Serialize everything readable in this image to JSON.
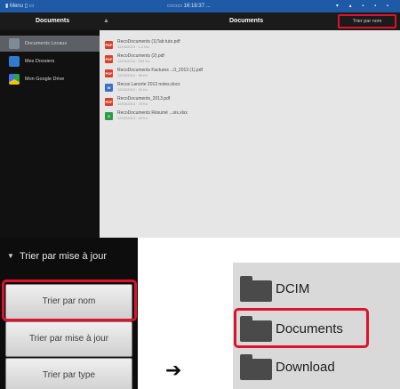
{
  "statusbar": {
    "left": "▮ Menu   ▯  ▭",
    "center": "▭▭▭ 16:18:37 ...",
    "right": "▾ ▴ ▪ ▪ ▪"
  },
  "actionbar": {
    "left_title": "Documents",
    "arrow": "▲",
    "center_title": "Documents",
    "sort_button": "Trier par nom"
  },
  "sidebar": {
    "items": [
      {
        "label": "Documents Locaux",
        "icon": "tablet-icon",
        "color": "#7f8a99",
        "active": true
      },
      {
        "label": "Mes Dossiers",
        "icon": "dropbox-icon",
        "color": "#2f7bd1",
        "active": false
      },
      {
        "label": "Mon Google Drive",
        "icon": "google-drive-icon",
        "color": "#2aa34a",
        "active": false
      }
    ],
    "toolbar": [
      "home-icon",
      "grid-icon",
      "folder-icon",
      "settings-icon"
    ]
  },
  "files": [
    {
      "name": "RecoDocuments (1)Tab tuto.pdf",
      "meta": "12/03/2013 · 1.2 Mo",
      "type": "PDF",
      "color": "#d8402e"
    },
    {
      "name": "RecoDocuments (2).pdf",
      "meta": "12/03/2013 · 340 Ko",
      "type": "PDF",
      "color": "#d8402e"
    },
    {
      "name": "RecoDocuments Factures ...0_2013 (1).pdf",
      "meta": "12/03/2013 · 98 Ko",
      "type": "PDF",
      "color": "#d8402e"
    },
    {
      "name": "Recos Lanorte 2013 notes.docx",
      "meta": "12/03/2013 · 22 Ko",
      "type": "W",
      "color": "#3a6fc4"
    },
    {
      "name": "RecoDocuments_2013.pdf",
      "meta": "12/03/2013 · 75 Ko",
      "type": "PDF",
      "color": "#d8402e"
    },
    {
      "name": "RecoDocuments Résumé ...ois.xlsx",
      "meta": "12/03/2013 · 18 Ko",
      "type": "X",
      "color": "#2e9a45"
    }
  ],
  "sort_panel": {
    "header": "Trier par mise à jour",
    "buttons": [
      "Trier par nom",
      "Trier par mise à jour",
      "Trier par type"
    ]
  },
  "next_arrow": "➔",
  "folders": [
    "DCIM",
    "Documents",
    "Download"
  ],
  "colors": {
    "highlight": "#e0112b",
    "statusbar": "#1f5aa6"
  }
}
